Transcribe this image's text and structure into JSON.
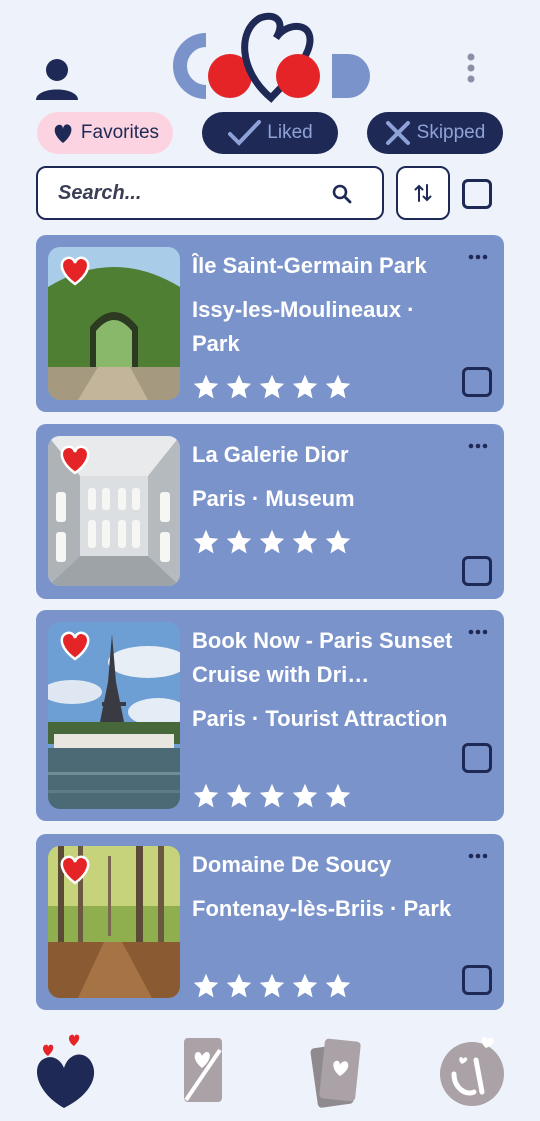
{
  "app": {
    "logo_text": "COMOD",
    "colors": {
      "navy": "#1e2a55",
      "card": "#7b93cb",
      "background": "#eef2fb",
      "heart": "#e52427",
      "chip_pink": "#fcd4e1",
      "chip_text": "#8fa2d8"
    }
  },
  "header": {
    "profile_icon": "user-icon",
    "menu_icon": "more-vertical-icon"
  },
  "filters": [
    {
      "label": "Favorites",
      "icon": "heart-icon",
      "active": true
    },
    {
      "label": "Liked",
      "icon": "check-icon",
      "active": false
    },
    {
      "label": "Skipped",
      "icon": "x-icon",
      "active": false
    }
  ],
  "search": {
    "placeholder": "Search...",
    "value": "",
    "icon": "search-icon",
    "sort_icon": "sort-icon"
  },
  "places": [
    {
      "title": "Île Saint-Germain Park",
      "subtitle": "Issy-les-Moulineaux · Park",
      "rating": 5
    },
    {
      "title": "La Galerie Dior",
      "subtitle": "Paris · Museum",
      "rating": 5
    },
    {
      "title": "Book Now - Paris Sunset Cruise with Dri…",
      "subtitle": "Paris · Tourist Attraction",
      "rating": 5
    },
    {
      "title": "Domaine De Soucy",
      "subtitle": "Fontenay-lès-Briis · Park",
      "rating": 5
    }
  ],
  "bottom_nav": [
    {
      "icon": "hearts-icon",
      "active": true
    },
    {
      "icon": "card-swipe-icon",
      "active": false
    },
    {
      "icon": "cards-stack-icon",
      "active": false
    },
    {
      "icon": "app-badge-icon",
      "active": false
    }
  ]
}
